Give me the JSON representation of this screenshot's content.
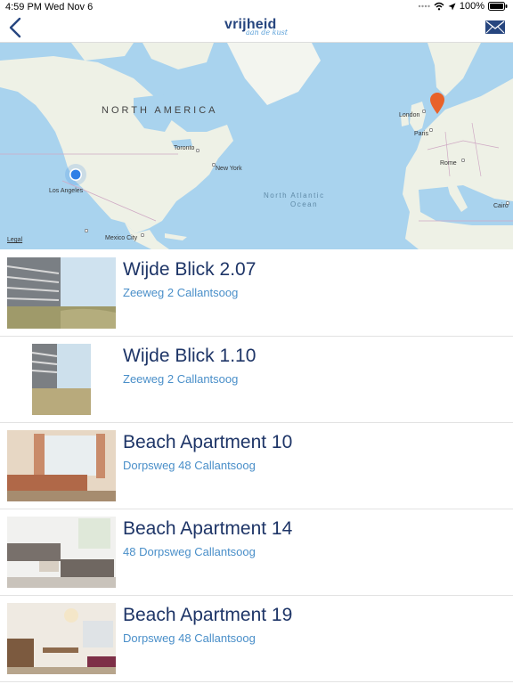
{
  "status": {
    "time": "4:59 PM",
    "date": "Wed Nov 6",
    "battery": "100%"
  },
  "nav": {
    "logo_main": "vrijheid",
    "logo_sub": "aan de kust"
  },
  "map": {
    "labels": {
      "north_america": "NORTH AMERICA",
      "los_angeles": "Los Angeles",
      "toronto": "Toronto",
      "new_york": "New York",
      "mexico_city": "Mexico City",
      "london": "London",
      "paris": "Paris",
      "rome": "Rome",
      "cairo": "Cairo",
      "ocean_1": "North Atlantic",
      "ocean_2": "Ocean"
    },
    "legal": "Legal",
    "colors": {
      "water": "#a9d3ee",
      "land": "#eef1e6",
      "pin": "#e8622a",
      "location": "#2f7fe6"
    }
  },
  "listings": [
    {
      "title": "Wijde Blick 2.07",
      "address": "Zeeweg 2 Callantsoog"
    },
    {
      "title": "Wijde Blick 1.10",
      "address": "Zeeweg 2 Callantsoog"
    },
    {
      "title": "Beach Apartment 10",
      "address": "Dorpsweg 48 Callantsoog"
    },
    {
      "title": "Beach Apartment 14",
      "address": "48 Dorpsweg Callantsoog"
    },
    {
      "title": "Beach Apartment 19",
      "address": "Dorpsweg 48 Callantsoog"
    }
  ]
}
